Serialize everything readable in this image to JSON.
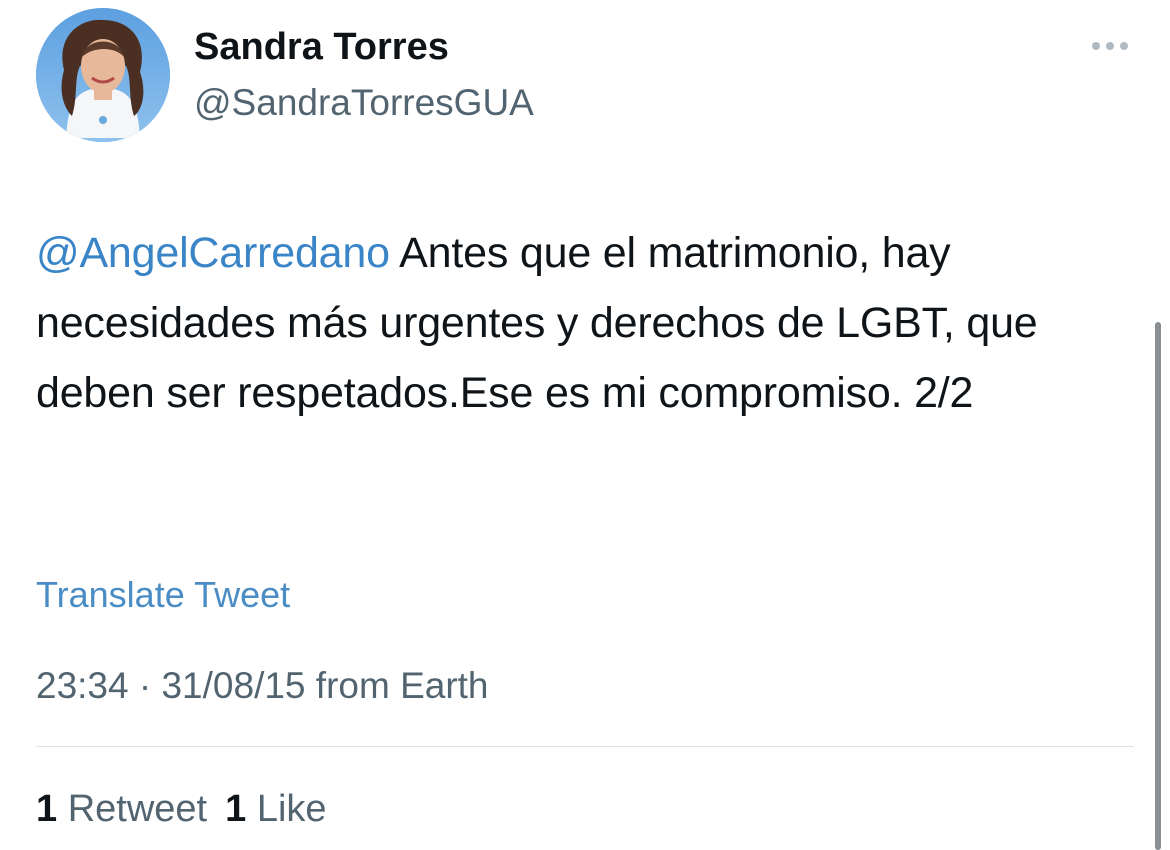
{
  "author": {
    "display_name": "Sandra Torres",
    "handle": "@SandraTorresGUA"
  },
  "tweet": {
    "mention": "@AngelCarredano",
    "text": " Antes que el matrimonio, hay necesidades más urgentes y derechos de LGBT, que deben ser respetados.Ese es mi compromiso. 2/2",
    "translate_label": "Translate Tweet",
    "time": "23:34",
    "separator": "·",
    "date": "31/08/15",
    "source": "from Earth"
  },
  "stats": {
    "retweets_count": "1",
    "retweets_label": "Retweet",
    "likes_count": "1",
    "likes_label": "Like"
  },
  "icons": {
    "more": "more-options-icon"
  },
  "colors": {
    "link": "#3a85c7",
    "secondary_text": "#536471",
    "primary_text": "#0f1419"
  }
}
